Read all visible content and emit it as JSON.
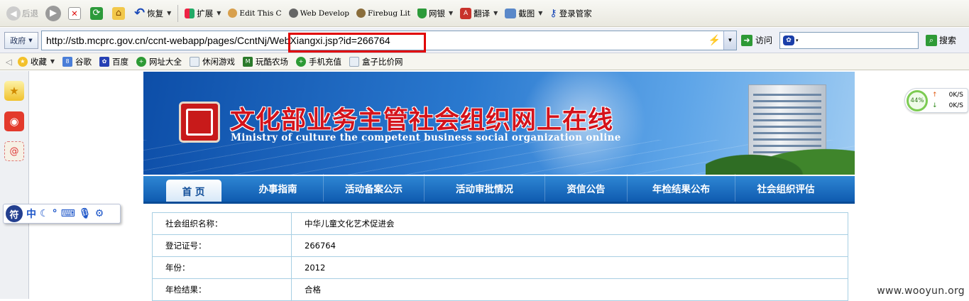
{
  "toolbar": {
    "back": "后退",
    "restore": "恢复",
    "extensions": "扩展",
    "edit_this": "Edit This C",
    "web_develop": "Web Develop",
    "firebug": "Firebug Lit",
    "bank": "网银",
    "translate": "翻译",
    "screenshot": "截图",
    "login_manager": "登录管家"
  },
  "address": {
    "zone": "政府",
    "url": "http://stb.mcprc.gov.cn/ccnt-webapp/pages/CcntNj/WebXiangxi.jsp?id=266764",
    "go": "访问",
    "search_btn": "搜索"
  },
  "favorites": {
    "label": "收藏",
    "items": [
      "谷歌",
      "百度",
      "网址大全",
      "休闲游戏",
      "玩酷农场",
      "手机充值",
      "盒子比价网"
    ]
  },
  "ime": {
    "logo": "符",
    "chinese": "中"
  },
  "banner": {
    "title": "文化部业务主管社会组织网上在线",
    "subtitle": "Ministry of culture the competent business social organization online"
  },
  "nav": [
    "首 页",
    "办事指南",
    "活动备案公示",
    "活动审批情况",
    "资信公告",
    "年检结果公布",
    "社会组织评估"
  ],
  "table": [
    {
      "key": "社会组织名称：",
      "value": "中华儿童文化艺术促进会"
    },
    {
      "key": "登记证号：",
      "value": "266764"
    },
    {
      "key": "年份：",
      "value": "2012"
    },
    {
      "key": "年检结果：",
      "value": "合格"
    }
  ],
  "speed": {
    "percent": "44%",
    "up": "0K/S",
    "down": "0K/S"
  },
  "watermark": "www.wooyun.org"
}
